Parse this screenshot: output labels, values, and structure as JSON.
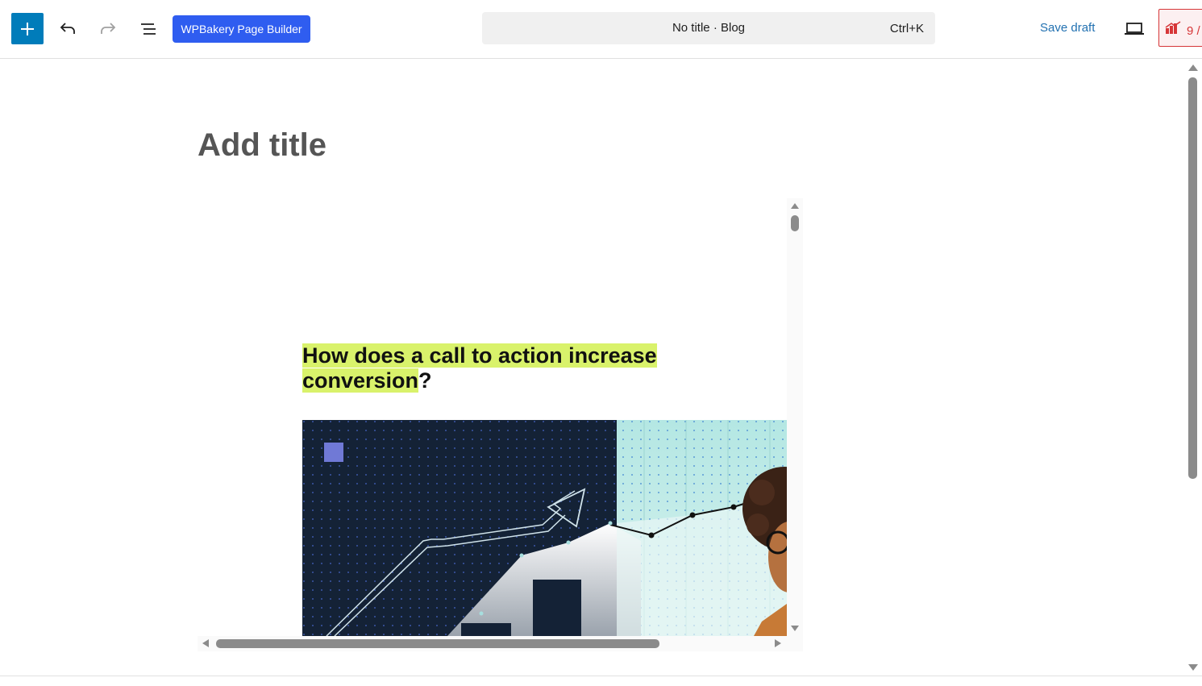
{
  "toolbar": {
    "page_builder_label": "WPBakery Page Builder",
    "document_title": "No title · Blog",
    "command_shortcut": "Ctrl+K",
    "save_draft_label": "Save draft",
    "seo_score": "9 /",
    "accent_color": "#007cba",
    "page_builder_color": "#2f5df0"
  },
  "editor": {
    "title_placeholder": "Add title"
  },
  "preview": {
    "heading_highlight": "How does a call to action increase conversion",
    "heading_tail": "?",
    "highlight_color": "#d9f26b"
  },
  "icons": [
    "plus-icon",
    "undo-icon",
    "redo-icon",
    "document-overview-icon",
    "laptop-icon",
    "seo-chart-icon"
  ]
}
